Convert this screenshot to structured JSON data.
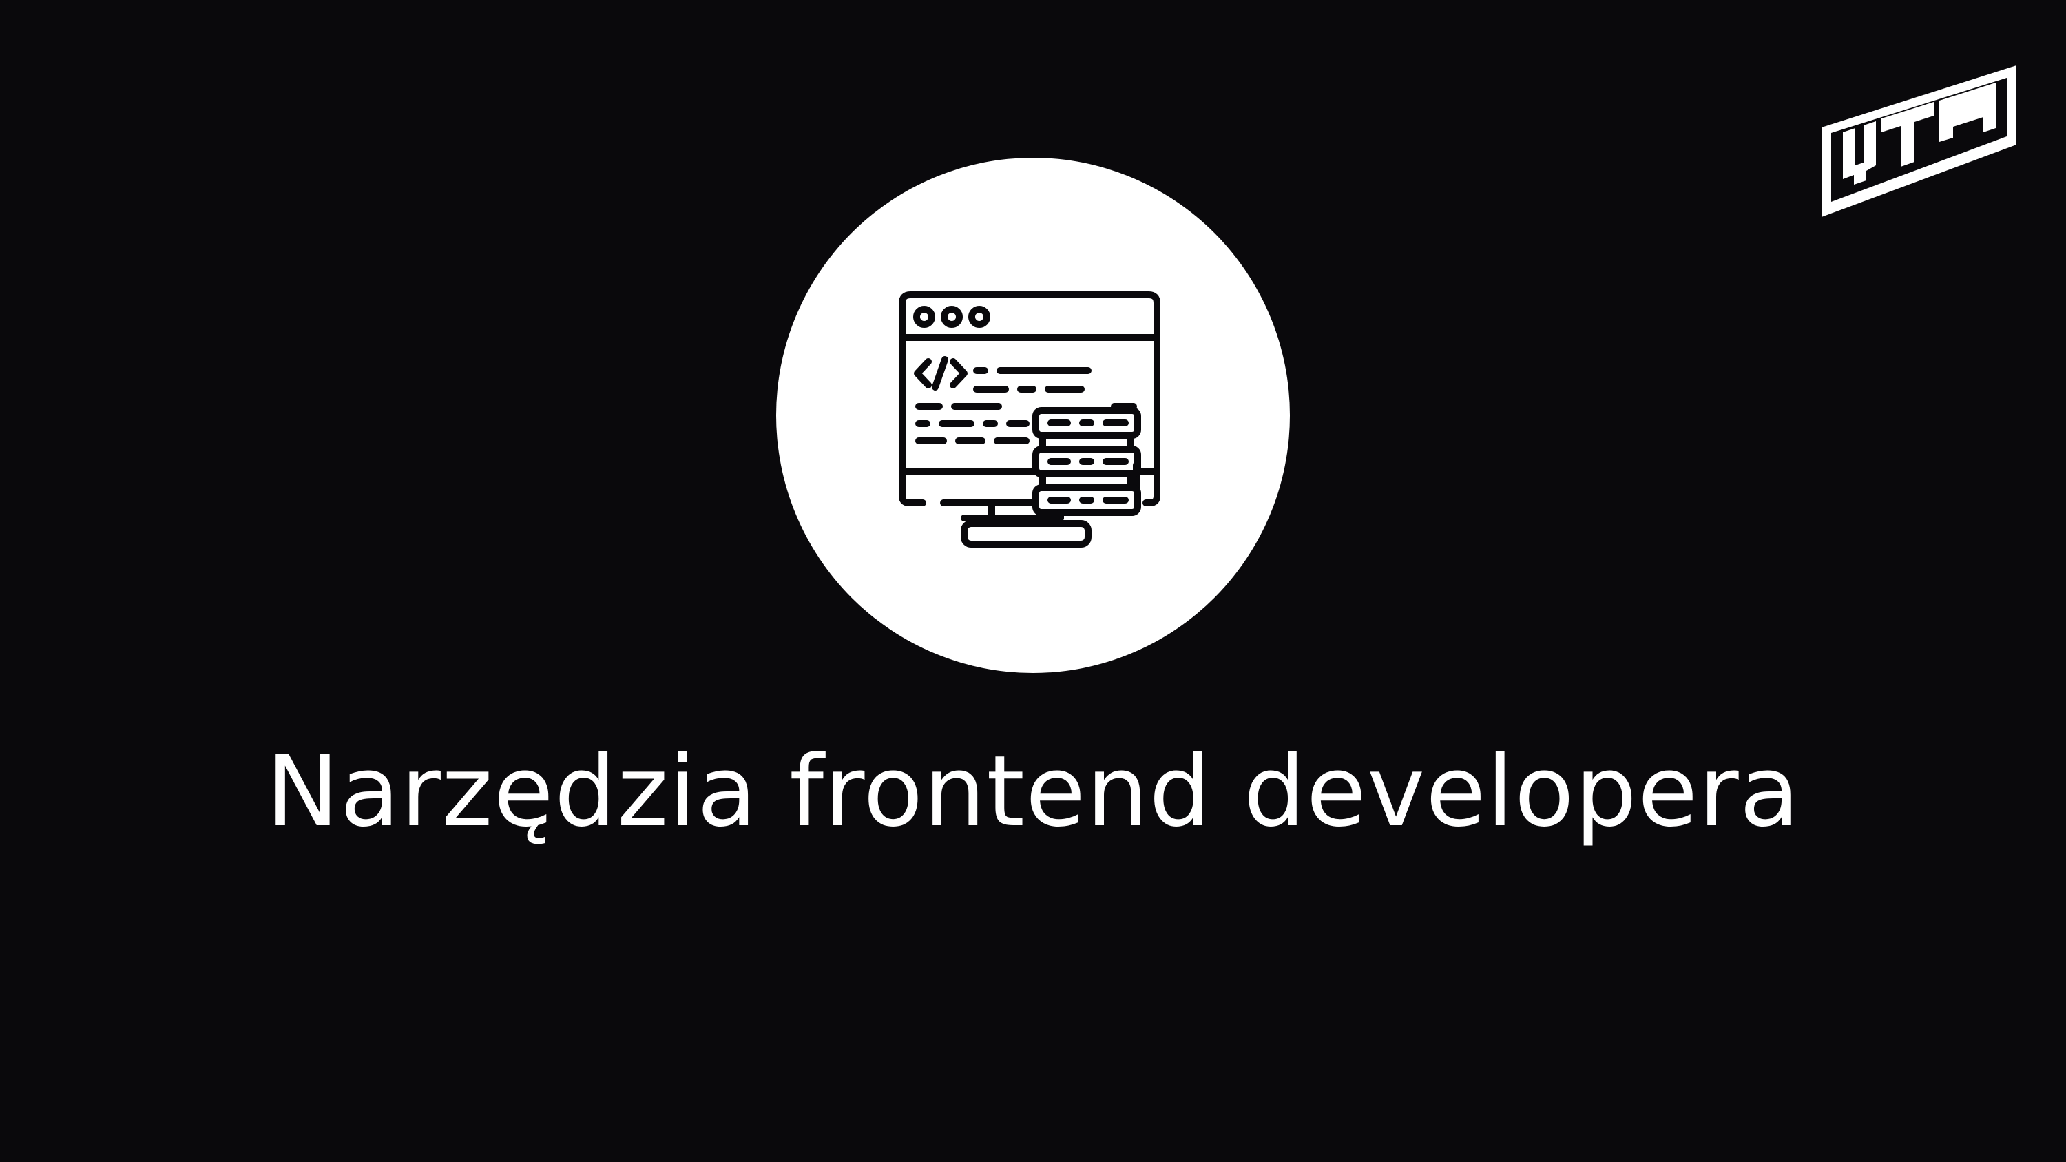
{
  "slide": {
    "title": "Narzędzia frontend developera",
    "background_color": "#0a090c",
    "foreground_color": "#ffffff"
  },
  "logo": {
    "text": "UTB",
    "icon": "brand-logo"
  },
  "illustration": {
    "icon": "frontend-code-window-icon",
    "circle_color": "#ffffff"
  }
}
